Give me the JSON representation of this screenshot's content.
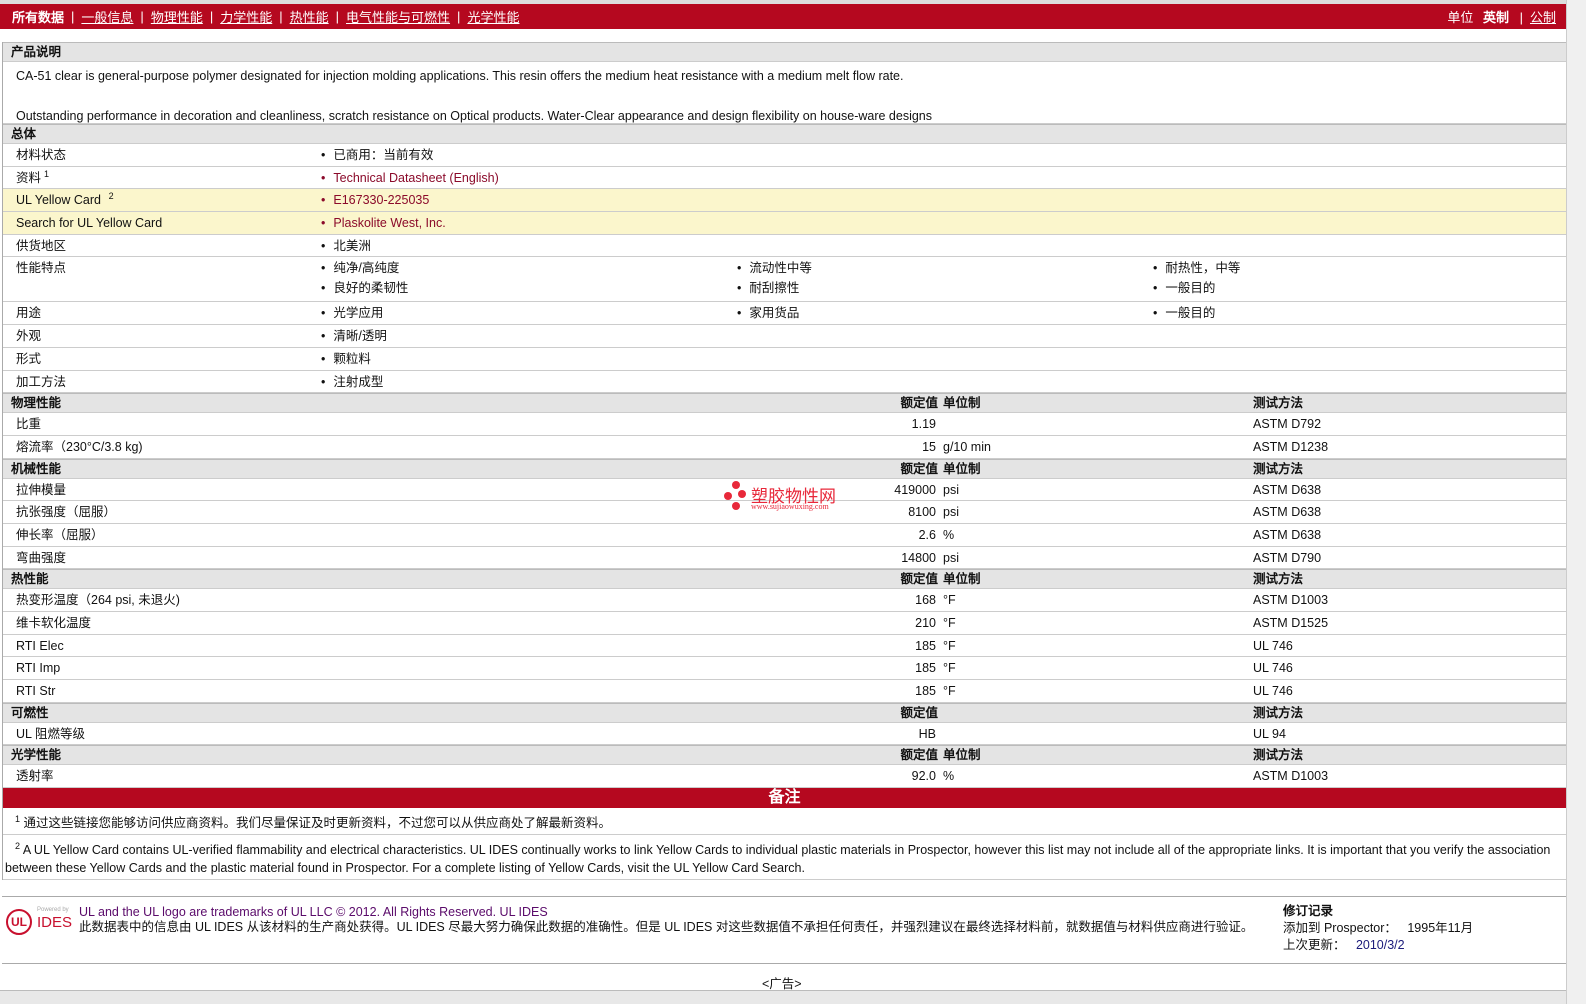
{
  "nav": {
    "items": [
      "所有数据",
      "一般信息",
      "物理性能",
      "力学性能",
      "热性能",
      "电气性能与可燃性",
      "光学性能"
    ],
    "units_label": "单位",
    "unit_imperial": "英制",
    "unit_metric": "公制"
  },
  "description": {
    "title": "产品说明",
    "line1": "CA-51 clear is general-purpose polymer designated for injection molding applications. This resin offers the medium heat resistance with a medium melt flow rate.",
    "line2": "Outstanding performance in decoration and cleanliness, scratch resistance on Optical products. Water-Clear appearance and design flexibility on house-ware designs"
  },
  "general": {
    "title": "总体",
    "rows": [
      {
        "label": "材料状态",
        "values": [
          "已商用：当前有效"
        ]
      },
      {
        "label": "资料",
        "sup": "1",
        "values": [
          "Technical Datasheet (English)"
        ],
        "link": true
      },
      {
        "label": "UL Yellow Card",
        "sup": "2",
        "values": [
          "E167330-225035"
        ],
        "link": true,
        "hl": true
      },
      {
        "label": "Search for UL Yellow Card",
        "values": [
          "Plaskolite West, Inc."
        ],
        "link": true,
        "hl": true
      },
      {
        "label": "供货地区",
        "values": [
          "北美洲"
        ]
      },
      {
        "label": "性能特点",
        "values": [
          "纯净/高纯度",
          "流动性中等",
          "耐热性，中等",
          "良好的柔韧性",
          "耐刮擦性",
          "一般目的"
        ]
      },
      {
        "label": "用途",
        "values": [
          "光学应用",
          "家用货品",
          "一般目的"
        ]
      },
      {
        "label": "外观",
        "values": [
          "清晰/透明"
        ]
      },
      {
        "label": "形式",
        "values": [
          "颗粒料"
        ]
      },
      {
        "label": "加工方法",
        "values": [
          "注射成型"
        ]
      }
    ]
  },
  "sections": [
    {
      "title": "物理性能",
      "h_val": "额定值",
      "h_unit": "单位制",
      "h_test": "测试方法",
      "rows": [
        {
          "label": "比重",
          "value": "1.19",
          "unit": "",
          "test": "ASTM D792"
        },
        {
          "label": "熔流率（230°C/3.8 kg)",
          "value": "15",
          "unit": "g/10 min",
          "test": "ASTM D1238"
        }
      ]
    },
    {
      "title": "机械性能",
      "h_val": "额定值",
      "h_unit": "单位制",
      "h_test": "测试方法",
      "rows": [
        {
          "label": "拉伸模量",
          "value": "419000",
          "unit": "psi",
          "test": "ASTM D638"
        },
        {
          "label": "抗张强度（屈服）",
          "value": "8100",
          "unit": "psi",
          "test": "ASTM D638"
        },
        {
          "label": "伸长率（屈服）",
          "value": "2.6",
          "unit": "%",
          "test": "ASTM D638"
        },
        {
          "label": "弯曲强度",
          "value": "14800",
          "unit": "psi",
          "test": "ASTM D790"
        }
      ]
    },
    {
      "title": "热性能",
      "h_val": "额定值",
      "h_unit": "单位制",
      "h_test": "测试方法",
      "rows": [
        {
          "label": "热变形温度（264 psi, 未退火)",
          "value": "168",
          "unit": "°F",
          "test": "ASTM D1003"
        },
        {
          "label": "维卡软化温度",
          "value": "210",
          "unit": "°F",
          "test": "ASTM D1525"
        },
        {
          "label": "RTI Elec",
          "value": "185",
          "unit": "°F",
          "test": "UL 746"
        },
        {
          "label": "RTI Imp",
          "value": "185",
          "unit": "°F",
          "test": "UL 746"
        },
        {
          "label": "RTI Str",
          "value": "185",
          "unit": "°F",
          "test": "UL 746"
        }
      ]
    },
    {
      "title": "可燃性",
      "h_val": "额定值",
      "h_unit": "",
      "h_test": "测试方法",
      "rows": [
        {
          "label": "UL 阻燃等级",
          "value": "HB",
          "unit": "",
          "test": "UL 94"
        }
      ]
    },
    {
      "title": "光学性能",
      "h_val": "额定值",
      "h_unit": "单位制",
      "h_test": "测试方法",
      "rows": [
        {
          "label": "透射率",
          "value": "92.0",
          "unit": "%",
          "test": "ASTM D1003"
        }
      ]
    }
  ],
  "notes": {
    "title": "备注",
    "fn1_sup": "1",
    "fn1": "通过这些链接您能够访问供应商资料。我们尽量保证及时更新资料，不过您可以从供应商处了解最新资料。",
    "fn2_sup": "2",
    "fn2": "A UL Yellow Card contains UL-verified flammability and electrical characteristics. UL IDES continually works to link Yellow Cards to individual plastic materials in Prospector, however this list may not include all of the appropriate links. It is important that you verify the association between these Yellow Cards and the plastic material found in Prospector. For a complete listing of Yellow Cards, visit the UL Yellow Card Search."
  },
  "watermark": {
    "name": "塑胶物性网",
    "url": "www.sujiaowuxing.com"
  },
  "footer": {
    "logo_powered": "Powered by",
    "logo_text": "IDES",
    "logo_ul": "UL",
    "trademark": "UL and the UL logo are trademarks of UL LLC © 2012. All Rights Reserved. UL IDES",
    "disclaimer": "此数据表中的信息由 UL IDES 从该材料的生产商处获得。UL IDES 尽最大努力确保此数据的准确性。但是 UL IDES 对这些数据值不承担任何责任，并强烈建议在最终选择材料前，就数据值与材料供应商进行验证。",
    "rev_title": "修订记录",
    "added_label": "添加到 Prospector：",
    "added_value": "1995年11月",
    "updated_label": "上次更新：",
    "updated_value": "2010/3/2"
  },
  "ad": "<广告>"
}
